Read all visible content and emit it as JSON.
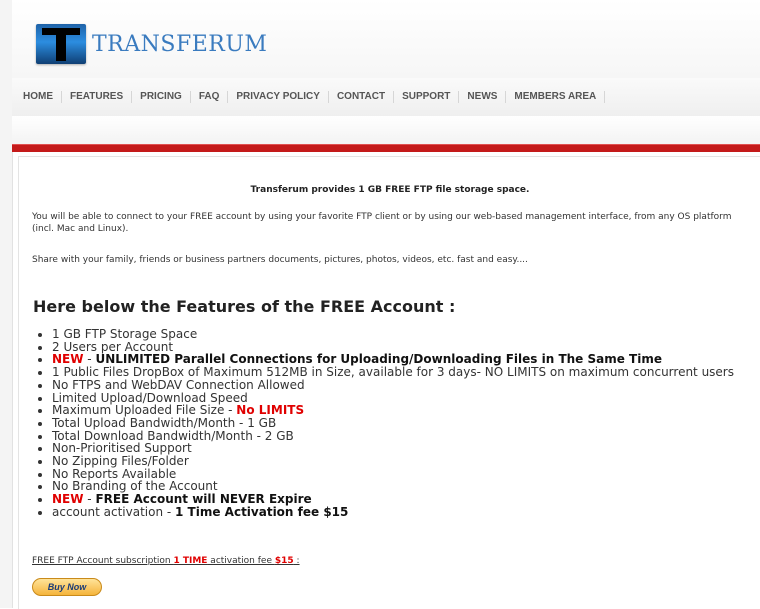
{
  "header": {
    "logo_letter": "T",
    "logo_text": "TRANSFERUM"
  },
  "nav": {
    "items": [
      "HOME",
      "FEATURES",
      "PRICING",
      "FAQ",
      "PRIVACY POLICY",
      "CONTACT",
      "SUPPORT",
      "NEWS",
      "MEMBERS AREA"
    ]
  },
  "colors": {
    "accent_red": "#c41a1a",
    "highlight_red": "#e00000",
    "logo_blue": "#3a7bbf"
  },
  "content": {
    "intro_bold": "Transferum provides 1 GB FREE FTP file storage space.",
    "paragraph1": "You will be able to connect to your FREE account by using your favorite FTP client or by using our web-based management interface, from any OS platform (incl. Mac and Linux).",
    "paragraph2": "Share with your family, friends or business partners documents, pictures, photos, videos, etc. fast and easy....",
    "features_title": "Here below the Features of the FREE Account :",
    "features": {
      "f1": "1 GB FTP Storage Space",
      "f2": "2 Users per Account",
      "f3_new": "NEW",
      "f3_sep": " - ",
      "f3_text": "UNLIMITED Parallel Connections for Uploading/Downloading Files in The Same Time",
      "f4": "1 Public Files DropBox of Maximum 512MB in Size, available for 3 days- NO LIMITS on maximum concurrent users",
      "f5": "No FTPS and WebDAV Connection Allowed",
      "f6": "Limited Upload/Download Speed",
      "f7_text": "Maximum Uploaded File Size - ",
      "f7_red": "No LIMITS",
      "f8": "Total Upload Bandwidth/Month - 1 GB",
      "f9": "Total Download Bandwidth/Month - 2 GB",
      "f10": "Non-Prioritised Support",
      "f11": "No Zipping Files/Folder",
      "f12": "No Reports Available",
      "f13": "No Branding of the Account",
      "f14_new": "NEW",
      "f14_sep": " - ",
      "f14_text": "FREE Account will NEVER Expire",
      "f15_text": "account activation - ",
      "f15_bold": "1 Time Activation fee $15"
    },
    "subscription": {
      "prefix": "FREE FTP Account subscription ",
      "red1": "1 TIME",
      "middle": " activation fee ",
      "red2": "$15",
      "suffix": " :"
    },
    "buy_button": "Buy Now"
  }
}
